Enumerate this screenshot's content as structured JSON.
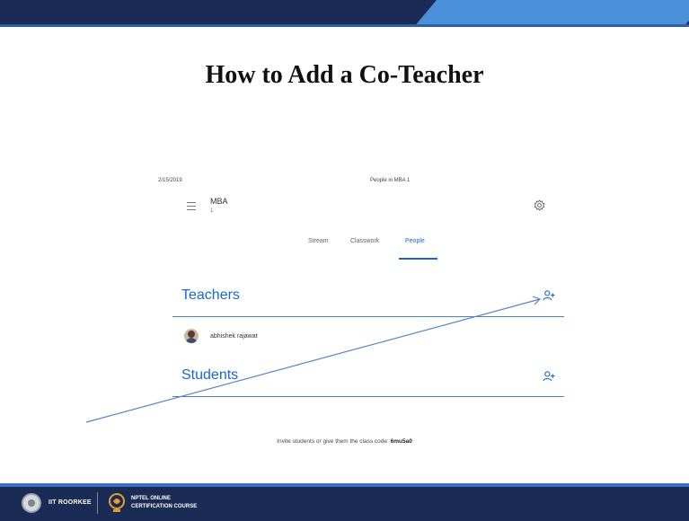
{
  "slide": {
    "title": "How to Add a Co-Teacher"
  },
  "printout": {
    "date": "2/15/2019",
    "page_title": "People in MBA 1",
    "class_name": "MBA",
    "class_section": "1",
    "tabs": [
      {
        "label": "Stream",
        "active": false
      },
      {
        "label": "Classwork",
        "active": false
      },
      {
        "label": "People",
        "active": true
      }
    ],
    "teachers_heading": "Teachers",
    "teacher_name": "abhishek rajawat",
    "students_heading": "Students",
    "invite_text": "Invite students or give them the class code:",
    "class_code": "6mu5a0"
  },
  "footer": {
    "institute": "IIT ROORKEE",
    "nptel_line1": "NPTEL ONLINE",
    "nptel_line2": "CERTIFICATION COURSE"
  },
  "colors": {
    "header_dark": "#1a2c55",
    "header_light": "#4a90d9",
    "classroom_blue": "#1967d2"
  },
  "icons": [
    "hamburger-icon",
    "gear-icon",
    "add-teacher-icon",
    "add-student-icon"
  ]
}
